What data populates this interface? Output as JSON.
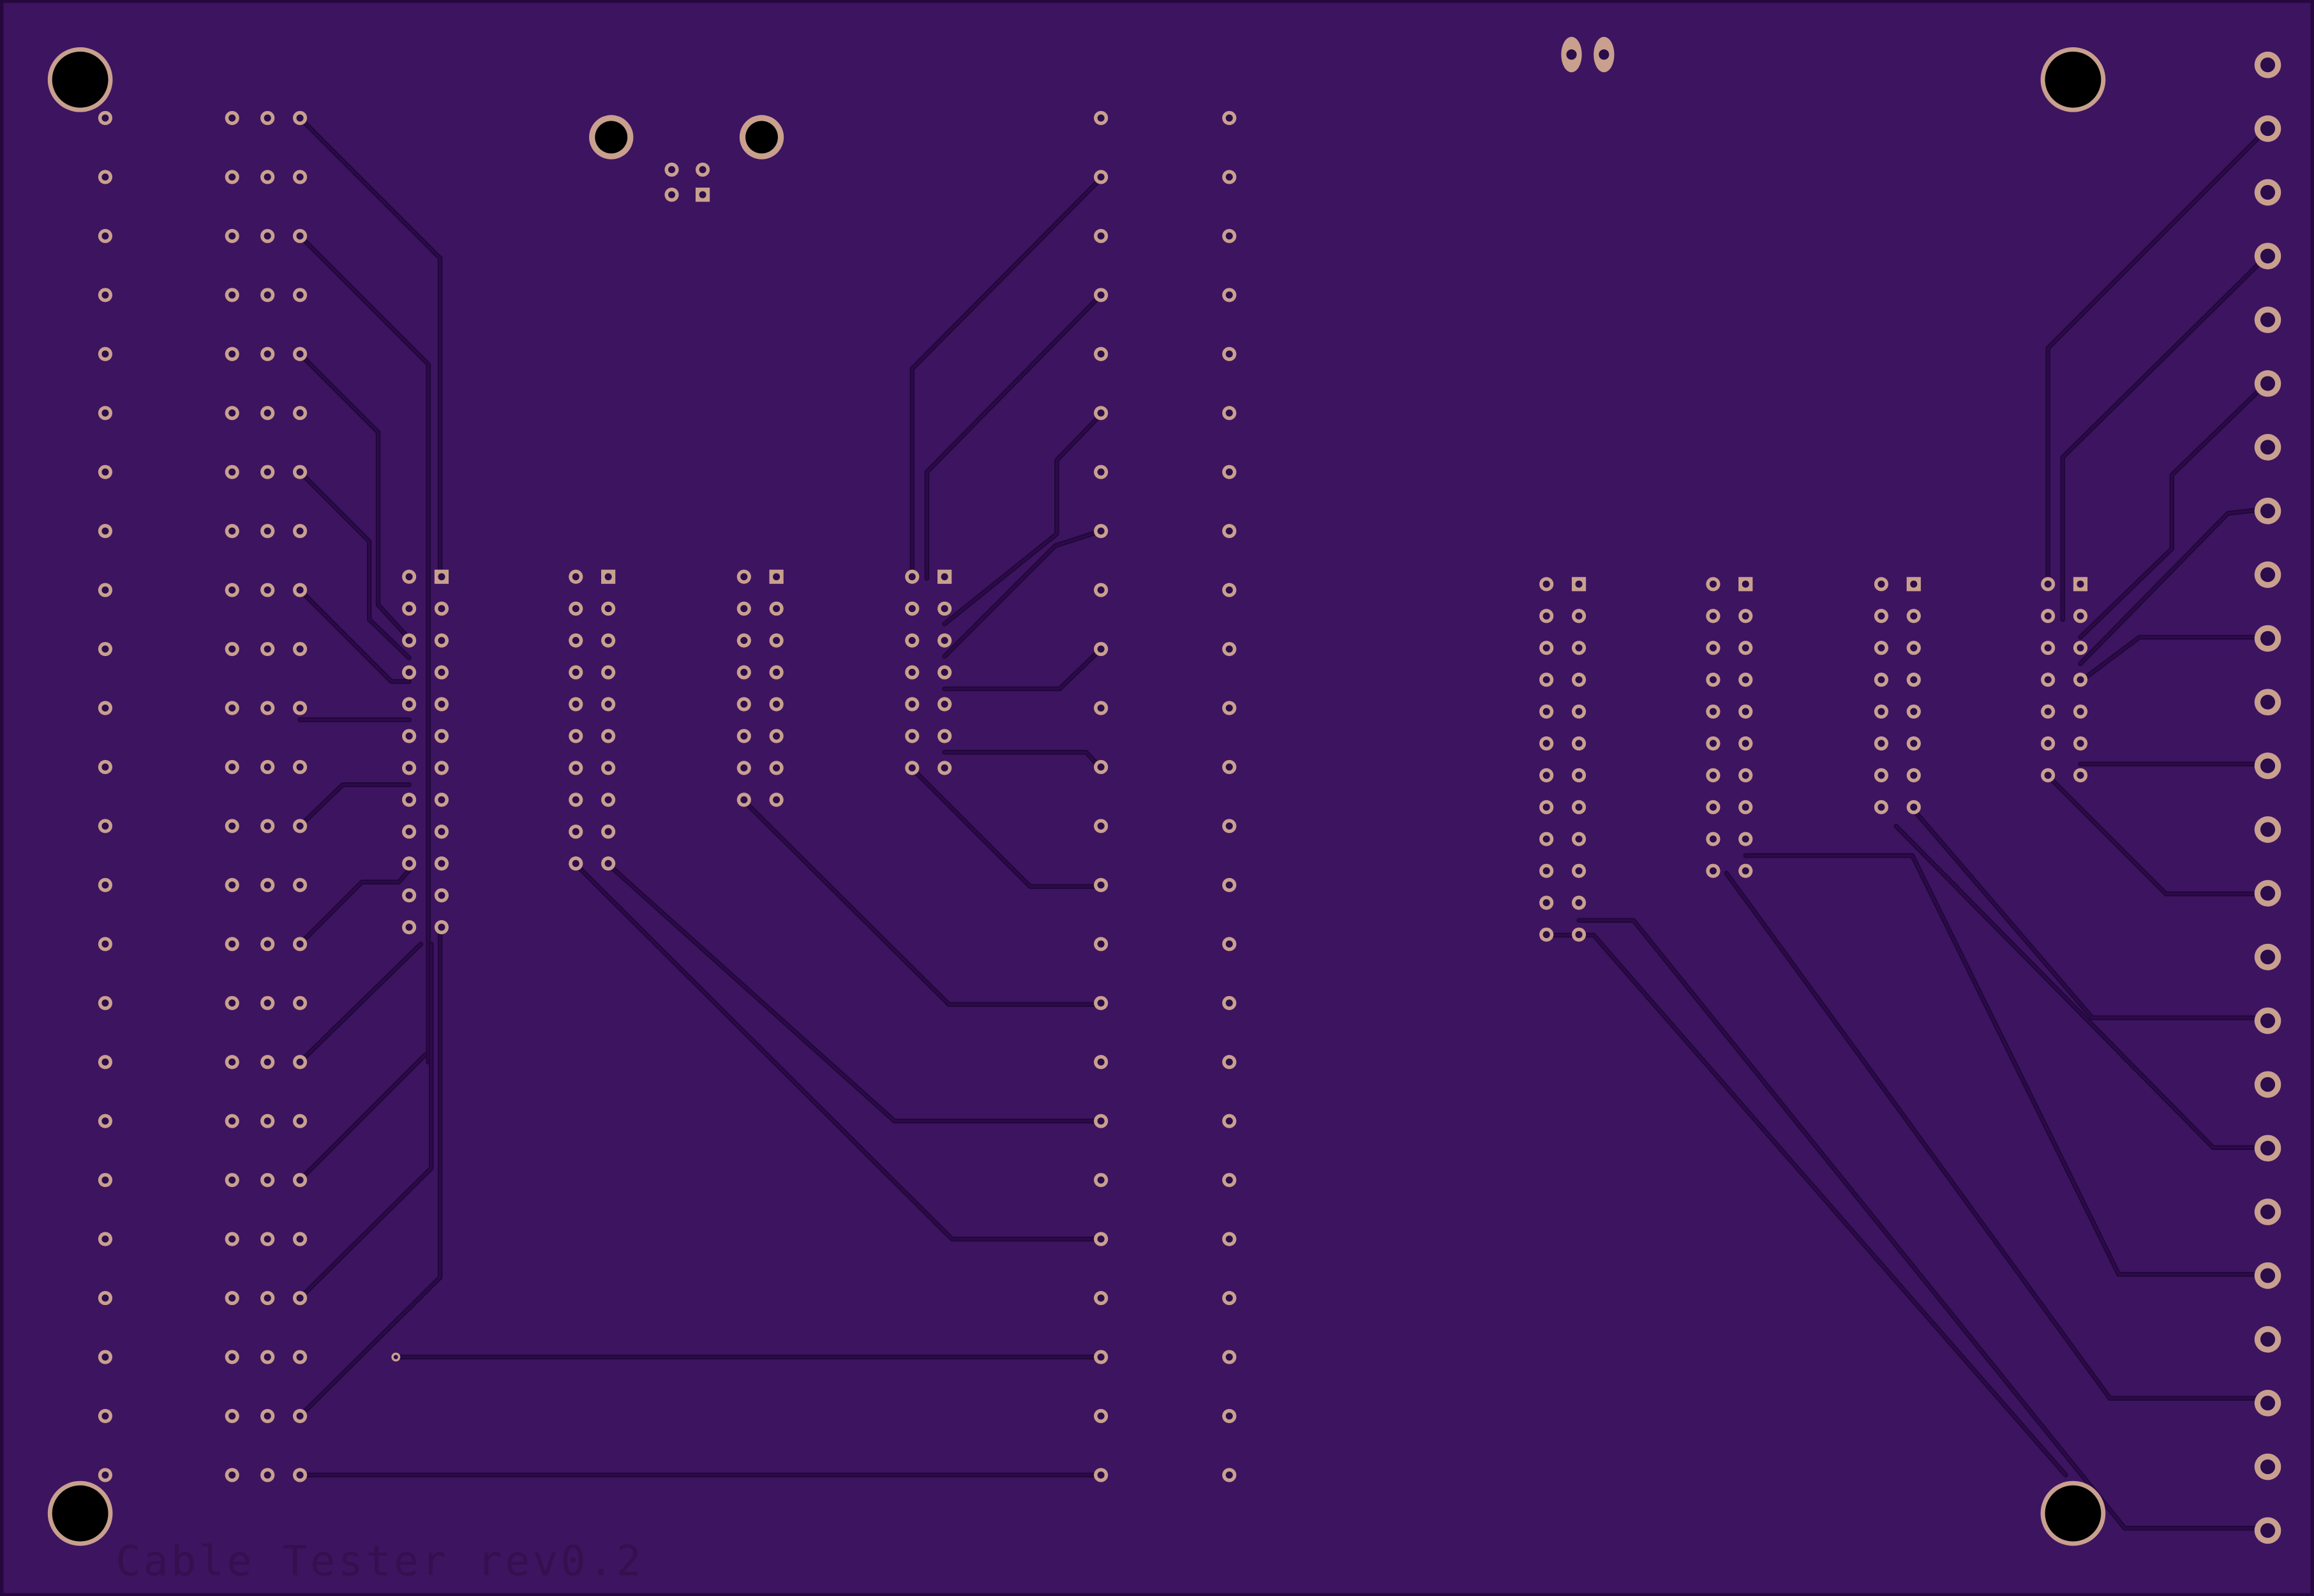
{
  "board": {
    "silkscreen_label": "Cable Tester rev0.2",
    "colors": {
      "substrate": "#3d1460",
      "edge": "#26083f",
      "trace": "#2c0a48",
      "trace_edge": "#1e0636",
      "pad_ring": "#c9a08e",
      "drill": "#2a0d4a",
      "mount_hole": "#000000",
      "silk_text": "#34104f"
    }
  }
}
